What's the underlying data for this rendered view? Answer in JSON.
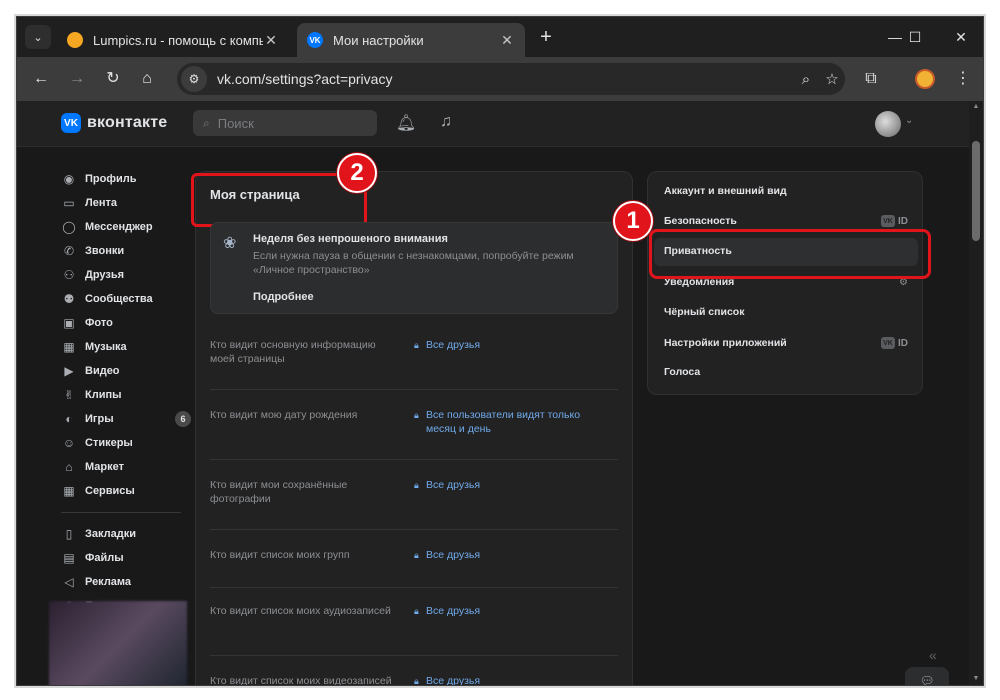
{
  "browser": {
    "tabs": [
      {
        "title": "Lumpics.ru - помощь с компью",
        "active": false
      },
      {
        "title": "Мои настройки",
        "active": true
      }
    ],
    "url": "vk.com/settings?act=privacy",
    "new_tab_symbol": "+",
    "window_controls": {
      "minimize": "—",
      "maximize": "☐",
      "close": "✕"
    }
  },
  "vk": {
    "logo_text": "вконтакте",
    "search_placeholder": "Поиск",
    "nav_primary": [
      {
        "label": "Профиль",
        "icon": "profile-icon"
      },
      {
        "label": "Лента",
        "icon": "feed-icon"
      },
      {
        "label": "Мессенджер",
        "icon": "messenger-icon"
      },
      {
        "label": "Звонки",
        "icon": "phone-icon"
      },
      {
        "label": "Друзья",
        "icon": "friends-icon"
      },
      {
        "label": "Сообщества",
        "icon": "communities-icon"
      },
      {
        "label": "Фото",
        "icon": "photo-icon"
      },
      {
        "label": "Музыка",
        "icon": "music-icon"
      },
      {
        "label": "Видео",
        "icon": "video-icon"
      },
      {
        "label": "Клипы",
        "icon": "clips-icon"
      },
      {
        "label": "Игры",
        "icon": "games-icon",
        "badge": "6"
      },
      {
        "label": "Стикеры",
        "icon": "stickers-icon"
      },
      {
        "label": "Маркет",
        "icon": "market-icon"
      },
      {
        "label": "Сервисы",
        "icon": "services-icon"
      }
    ],
    "nav_secondary": [
      {
        "label": "Закладки",
        "icon": "bookmark-icon"
      },
      {
        "label": "Файлы",
        "icon": "files-icon"
      },
      {
        "label": "Реклама",
        "icon": "ads-icon"
      },
      {
        "label": "Помощь",
        "icon": "help-icon"
      }
    ],
    "main": {
      "title": "Моя страница",
      "banner": {
        "title": "Неделя без непрошеного внимания",
        "text": "Если нужна пауза в общении с незнакомцами, попробуйте режим «Личное пространство»",
        "link": "Подробнее"
      },
      "privacy_rows": [
        {
          "question": "Кто видит основную информацию моей страницы",
          "answer": "Все друзья"
        },
        {
          "question": "Кто видит мою дату рождения",
          "answer": "Все пользователи видят только месяц и день"
        },
        {
          "question": "Кто видит мои сохранённые фотографии",
          "answer": "Все друзья"
        },
        {
          "question": "Кто видит список моих групп",
          "answer": "Все друзья"
        },
        {
          "question": "Кто видит список моих аудиозаписей",
          "answer": "Все друзья"
        },
        {
          "question": "Кто видит список моих видеозаписей",
          "answer": "Все друзья"
        }
      ]
    },
    "settings_menu": [
      {
        "label": "Аккаунт и внешний вид",
        "tag": ""
      },
      {
        "label": "Безопасность",
        "tag": "ID"
      },
      {
        "label": "Приватность",
        "tag": "",
        "active": true
      },
      {
        "label": "Уведомления",
        "tag": ""
      },
      {
        "label": "Чёрный список",
        "tag": ""
      },
      {
        "label": "Настройки приложений",
        "tag": "ID"
      },
      {
        "label": "Голоса",
        "tag": ""
      }
    ]
  },
  "callouts": [
    "1",
    "2"
  ],
  "colors": {
    "highlight_red": "#e0141a",
    "vk_blue": "#0077ff",
    "link_blue": "#71aaeb"
  }
}
